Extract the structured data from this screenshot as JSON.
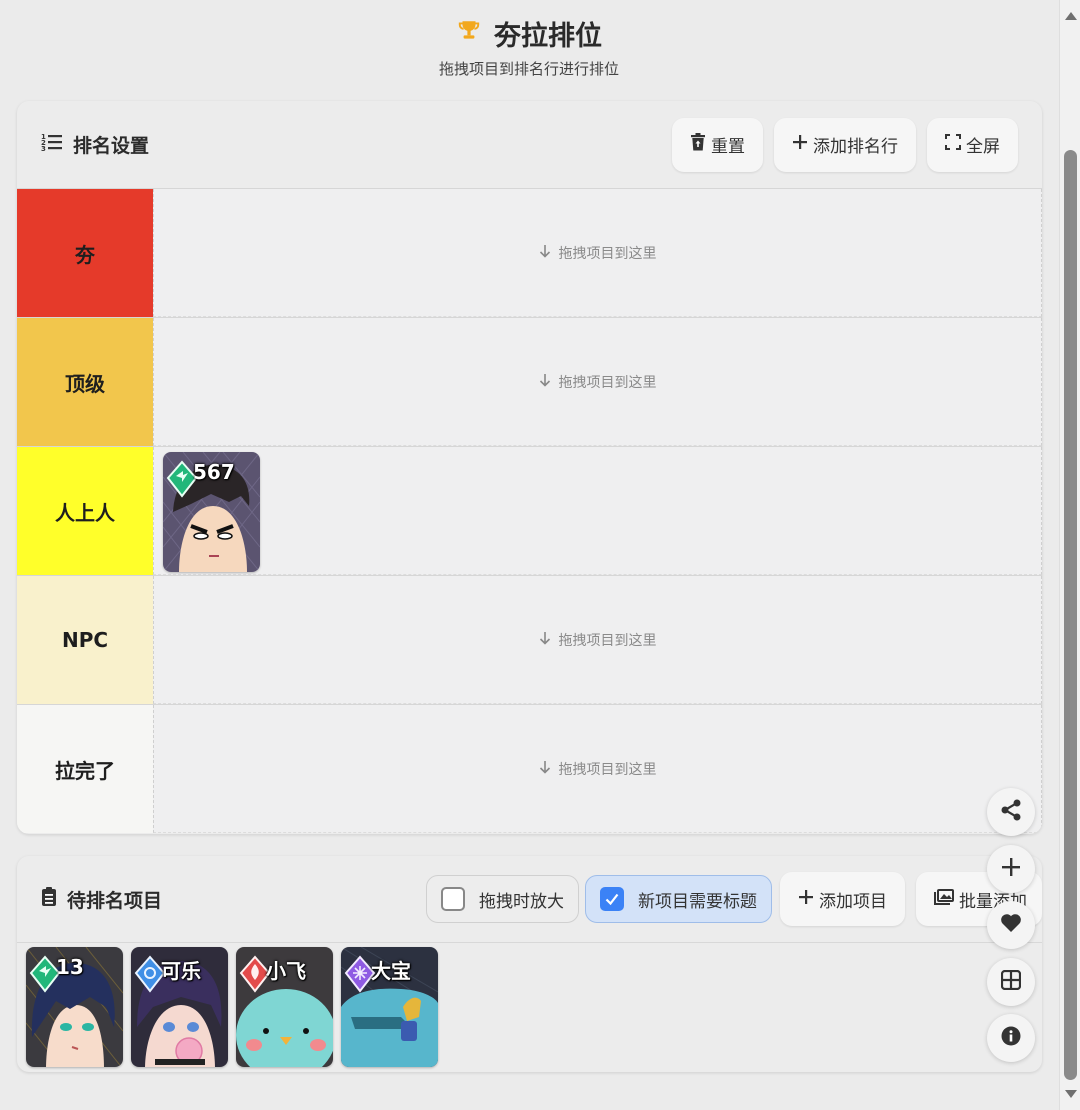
{
  "header": {
    "title": "夯拉排位",
    "subtitle": "拖拽项目到排名行进行排位"
  },
  "tier_card": {
    "title": "排名设置",
    "buttons": {
      "reset": "重置",
      "add_row": "添加排名行",
      "fullscreen": "全屏"
    },
    "drop_hint": "拖拽项目到这里",
    "rows": [
      {
        "label": "夯",
        "color": "#e53a2a",
        "items": []
      },
      {
        "label": "顶级",
        "color": "#f2c64c",
        "items": []
      },
      {
        "label": "人上人",
        "color": "#ffff2a",
        "items": [
          {
            "title": "567",
            "badge": "green",
            "art": "boy"
          }
        ]
      },
      {
        "label": "NPC",
        "color": "#f9f1cc",
        "items": []
      },
      {
        "label": "拉完了",
        "color": "#f6f6f4",
        "items": []
      }
    ]
  },
  "pending_card": {
    "title": "待排名项目",
    "toggles": {
      "zoom_on_drag": {
        "label": "拖拽时放大",
        "checked": false
      },
      "require_title": {
        "label": "新项目需要标题",
        "checked": true
      }
    },
    "buttons": {
      "add_item": "添加项目",
      "batch_add": "批量添加"
    },
    "items": [
      {
        "title": "13",
        "badge": "green",
        "art": "teal-hair"
      },
      {
        "title": "可乐",
        "badge": "blue",
        "art": "bubblegum"
      },
      {
        "title": "小飞",
        "badge": "red",
        "art": "bird"
      },
      {
        "title": "大宝",
        "badge": "purple",
        "art": "car"
      }
    ]
  },
  "colors": {
    "accent_blue": "#3b82f6",
    "badge_green": "#21b77a",
    "badge_blue": "#3f8fe6",
    "badge_red": "#e34b4b",
    "badge_purple": "#8f5be3"
  },
  "icons": [
    "trophy-icon",
    "list-ordered-icon",
    "trash-icon",
    "plus-icon",
    "fullscreen-icon",
    "arrow-down-icon",
    "clipboard-icon",
    "images-icon",
    "share-icon",
    "heart-icon",
    "grid-icon",
    "info-icon"
  ]
}
